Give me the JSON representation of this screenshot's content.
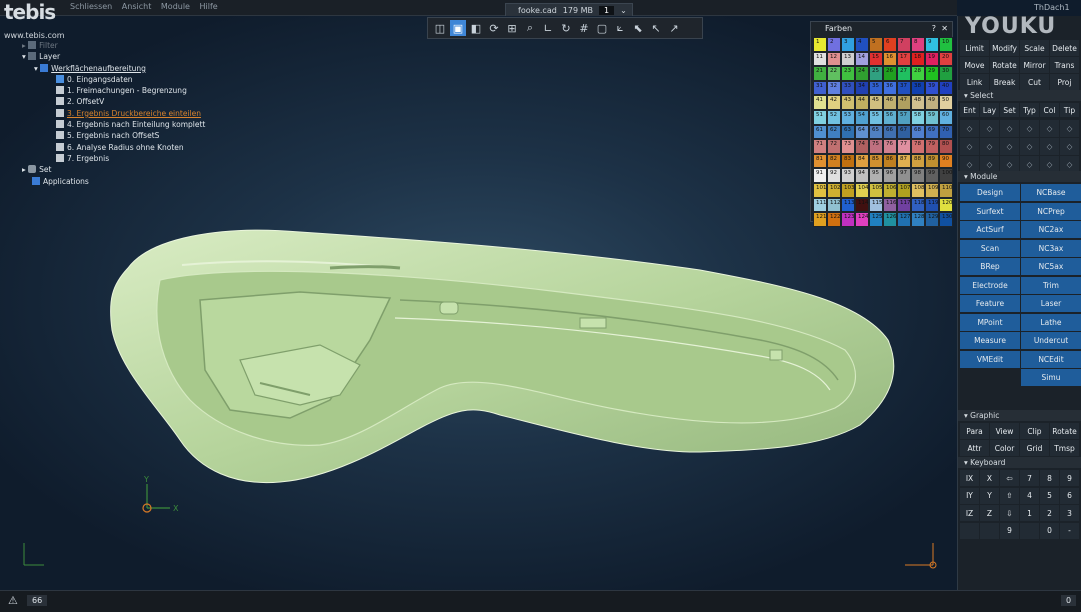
{
  "app": {
    "logo": "tebis",
    "logo_url": "www.tebis.com",
    "menu": [
      "Schliessen",
      "Ansicht",
      "Module",
      "Hilfe"
    ],
    "file_name": "fooke.cad",
    "memory": "179 MB",
    "window_num": "1",
    "user": "ThDach1"
  },
  "toolbar": {
    "icons": [
      "box-view-icon",
      "box-front-icon",
      "box-iso-icon",
      "rotate-view-icon",
      "fit-icon",
      "zoom-icon",
      "axis-icon",
      "refresh-icon",
      "grid-icon",
      "frame-icon",
      "dim-icon",
      "select-icon",
      "pick-icon",
      "pick-plus-icon"
    ]
  },
  "tree": {
    "filter": "Filter",
    "layer": "Layer",
    "folder": "Werkflächenaufbereitung",
    "items": [
      "0. Eingangsdaten",
      "1. Freimachungen - Begrenzung",
      "2. OffsetV",
      "3. Ergebnis Druckbereiche einteilen",
      "4. Ergebnis nach Einteilung komplett",
      "5. Ergebnis nach OffsetS",
      "6. Analyse Radius ohne Knoten",
      "7. Ergebnis"
    ],
    "set": "Set",
    "applications": "Applications"
  },
  "colors_panel": {
    "title": "Farben",
    "help": "?",
    "close": "✕"
  },
  "watermark": "YOUKU",
  "right_panel": {
    "top_buttons": [
      [
        "Limit",
        "Modify",
        "Scale",
        "Delete"
      ],
      [
        "Move",
        "Rotate",
        "Mirror",
        "Trans"
      ],
      [
        "Link",
        "Break",
        "Cut",
        "Proj"
      ]
    ],
    "select_label": "Select",
    "select_tabs": [
      "Ent",
      "Lay",
      "Set",
      "Typ",
      "Col",
      "Tip"
    ],
    "module_label": "Module",
    "module_buttons": [
      [
        "Design",
        "NCBase"
      ],
      [
        "Surfext",
        "NCPrep"
      ],
      [
        "ActSurf",
        "NC2ax"
      ],
      [
        "Scan",
        "NC3ax"
      ],
      [
        "BRep",
        "NC5ax"
      ],
      [
        "Electrode",
        "Trim"
      ],
      [
        "Feature",
        "Laser"
      ],
      [
        "MPoint",
        "Lathe"
      ],
      [
        "Measure",
        "Undercut"
      ],
      [
        "VMEdit",
        "NCEdit"
      ],
      [
        "",
        "Simu"
      ]
    ],
    "graphic_label": "Graphic",
    "graphic_buttons": [
      [
        "Para",
        "View",
        "Clip",
        "Rotate"
      ],
      [
        "Attr",
        "Color",
        "Grid",
        "Tmsp"
      ]
    ],
    "keyboard_label": "Keyboard",
    "keyboard_rows": [
      [
        "IX",
        "X",
        "⇦",
        "7",
        "8",
        "9"
      ],
      [
        "IY",
        "Y",
        "⇧",
        "4",
        "5",
        "6"
      ],
      [
        "IZ",
        "Z",
        "⇩",
        "1",
        "2",
        "3"
      ],
      [
        "",
        "",
        "9",
        "",
        "0",
        "-"
      ]
    ]
  },
  "status": {
    "count_left": "66",
    "count_right": "0"
  },
  "axes": {
    "x": "X",
    "y": "Y"
  }
}
